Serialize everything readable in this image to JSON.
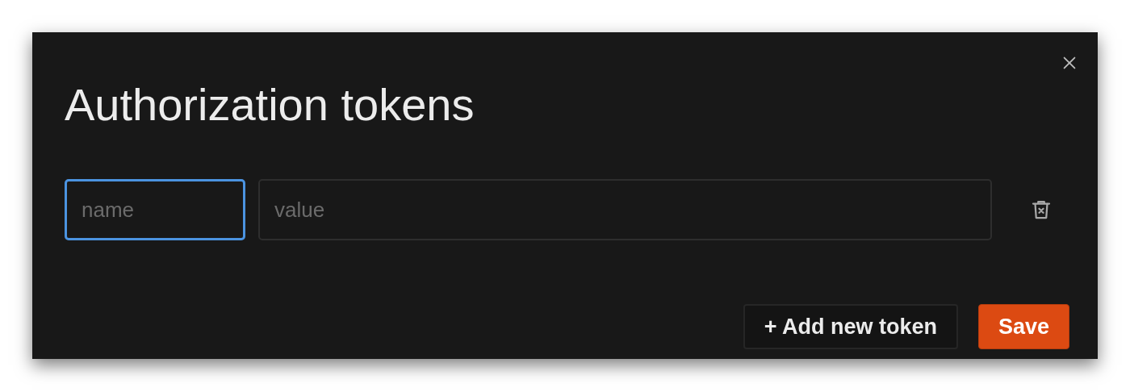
{
  "dialog": {
    "title": "Authorization tokens",
    "tokens": [
      {
        "fields": [
          {
            "placeholder": "name",
            "focused": true
          },
          {
            "placeholder": "value",
            "focused": false
          }
        ]
      }
    ],
    "buttons": [
      {
        "kind": "secondary",
        "label": "+ Add new token"
      },
      {
        "kind": "primary",
        "label": "Save"
      }
    ]
  }
}
